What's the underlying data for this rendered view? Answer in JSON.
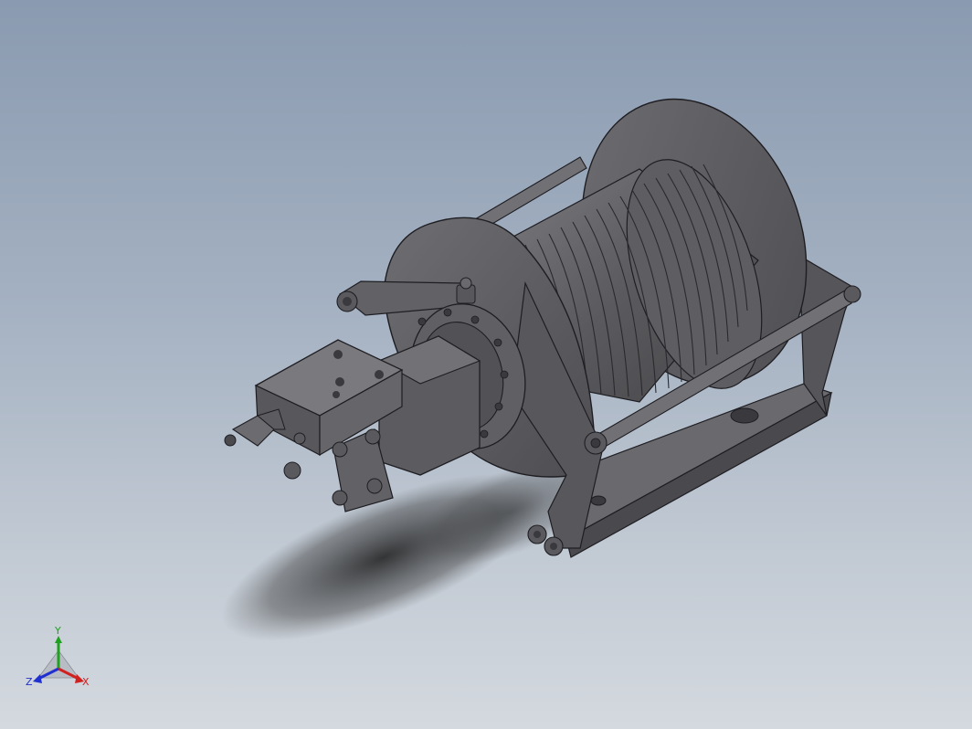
{
  "viewport": {
    "background_top": "#8a9ab0",
    "background_bottom": "#d4d9df",
    "model_color": "#5f5f63",
    "edge_color": "#1e1e22"
  },
  "triad": {
    "x_label": "X",
    "y_label": "Y",
    "z_label": "Z",
    "x_color": "#d02020",
    "y_color": "#20a020",
    "z_color": "#2030d0"
  }
}
